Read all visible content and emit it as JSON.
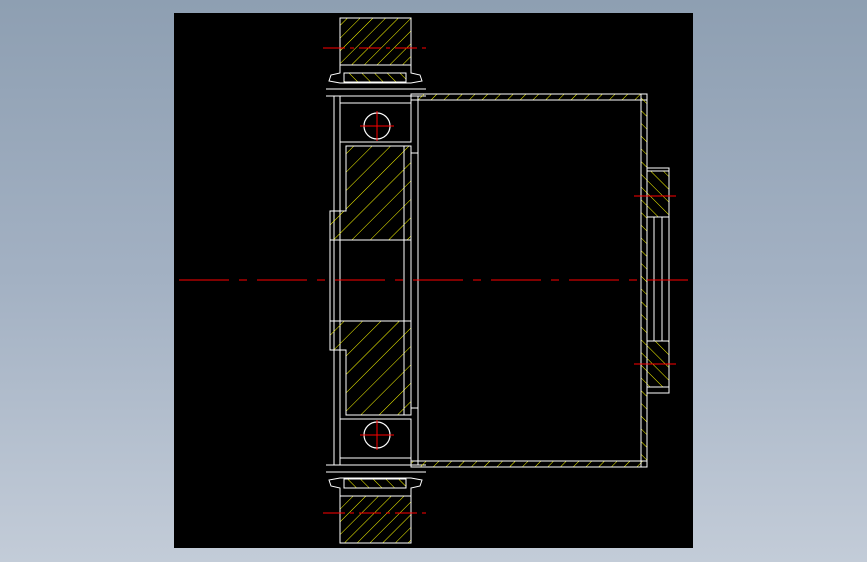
{
  "drawing": {
    "kind": "cad-sectional-view",
    "colors": {
      "background_outer": "#9aa9bb",
      "canvas": "#000000",
      "outline": "#ffffff",
      "hatch": "#ffff00",
      "centerline": "#ff0000"
    }
  }
}
